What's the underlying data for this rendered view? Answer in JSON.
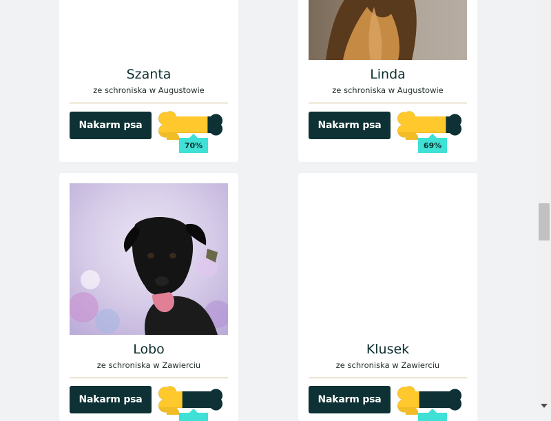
{
  "dogs": [
    {
      "name": "Szanta",
      "shelter": "ze schroniska w Augustowie",
      "button": "Nakarm psa",
      "fed_percent": 70,
      "fed_label": "70%"
    },
    {
      "name": "Linda",
      "shelter": "ze schroniska w Augustowie",
      "button": "Nakarm psa",
      "fed_percent": 69,
      "fed_label": "69%"
    },
    {
      "name": "Lobo",
      "shelter": "ze schroniska w Zawierciu",
      "button": "Nakarm psa",
      "fed_percent": 34,
      "fed_label": ""
    },
    {
      "name": "Klusek",
      "shelter": "ze schroniska w Zawierciu",
      "button": "Nakarm psa",
      "fed_percent": 31,
      "fed_label": ""
    }
  ],
  "colors": {
    "page_bg": "#f1f2f4",
    "button_bg": "#0d3134",
    "bone_fill": "#ffc82c",
    "bone_empty": "#0d3134",
    "badge": "#3fe0d5",
    "divider": "#c9b37a"
  }
}
